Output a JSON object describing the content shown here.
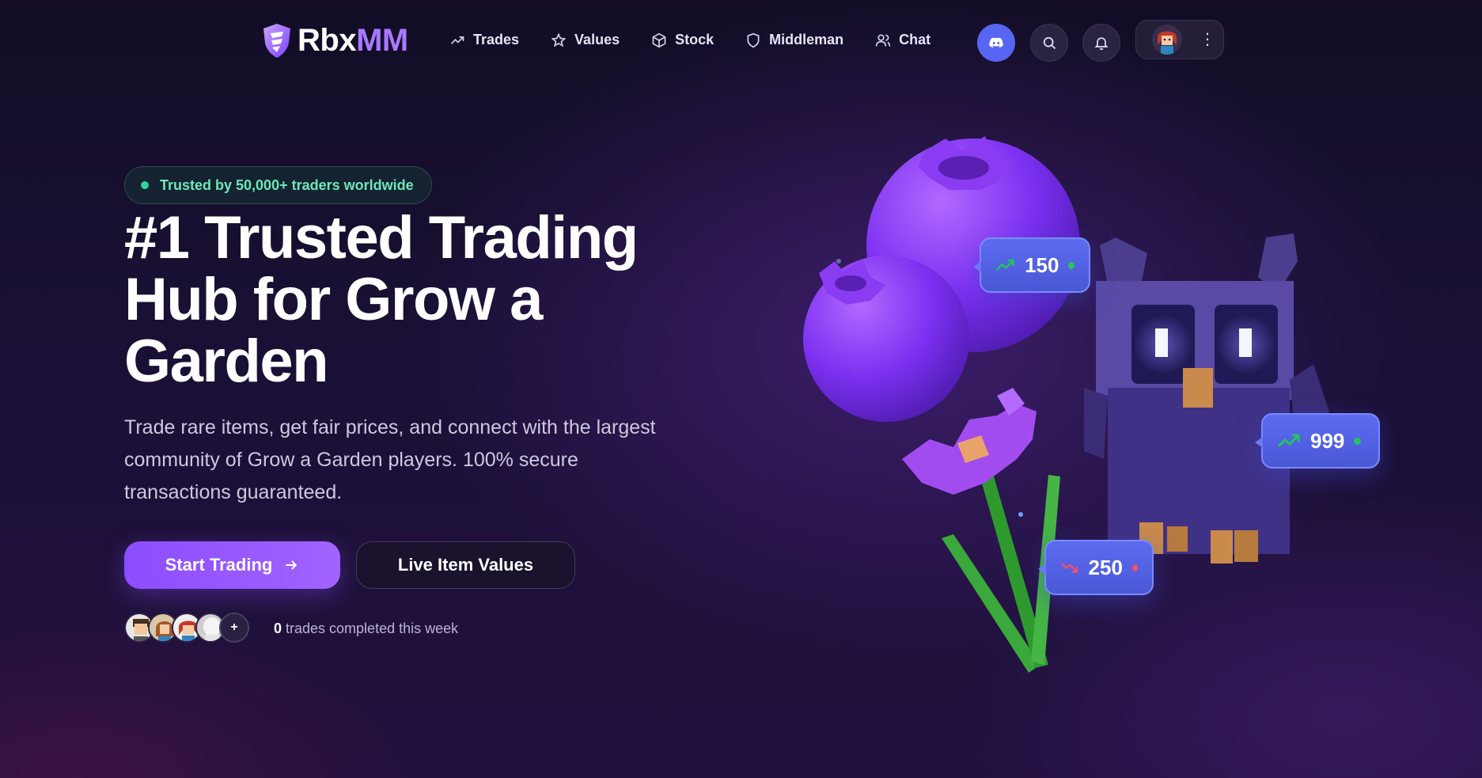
{
  "brand": {
    "name_a": "Rbx",
    "name_b": "MM"
  },
  "nav": {
    "links": [
      {
        "label": "Trades",
        "icon": "trend-up-icon"
      },
      {
        "label": "Values",
        "icon": "star-icon"
      },
      {
        "label": "Stock",
        "icon": "box-icon"
      },
      {
        "label": "Middleman",
        "icon": "shield-icon"
      },
      {
        "label": "Chat",
        "icon": "users-icon"
      }
    ],
    "kebab": "⋮"
  },
  "hero": {
    "badge": "Trusted by 50,000+ traders worldwide",
    "title": "#1 Trusted Trading Hub for Grow a Garden",
    "subtitle": "Trade rare items, get fair prices, and connect with the largest community of Grow a Garden players. 100% secure transactions guaranteed.",
    "primary_cta": "Start Trading",
    "secondary_cta": "Live Item Values",
    "avatars_more": "+",
    "trades_count": "0",
    "trades_suffix": " trades completed this week"
  },
  "price_tags": [
    {
      "value": "150",
      "trend": "up",
      "color": "#22c55e"
    },
    {
      "value": "999",
      "trend": "up",
      "color": "#22c55e"
    },
    {
      "value": "250",
      "trend": "down",
      "color": "#f0506e"
    }
  ],
  "colors": {
    "accent": "#a978ff",
    "discord": "#5865f2",
    "success": "#34d399"
  }
}
